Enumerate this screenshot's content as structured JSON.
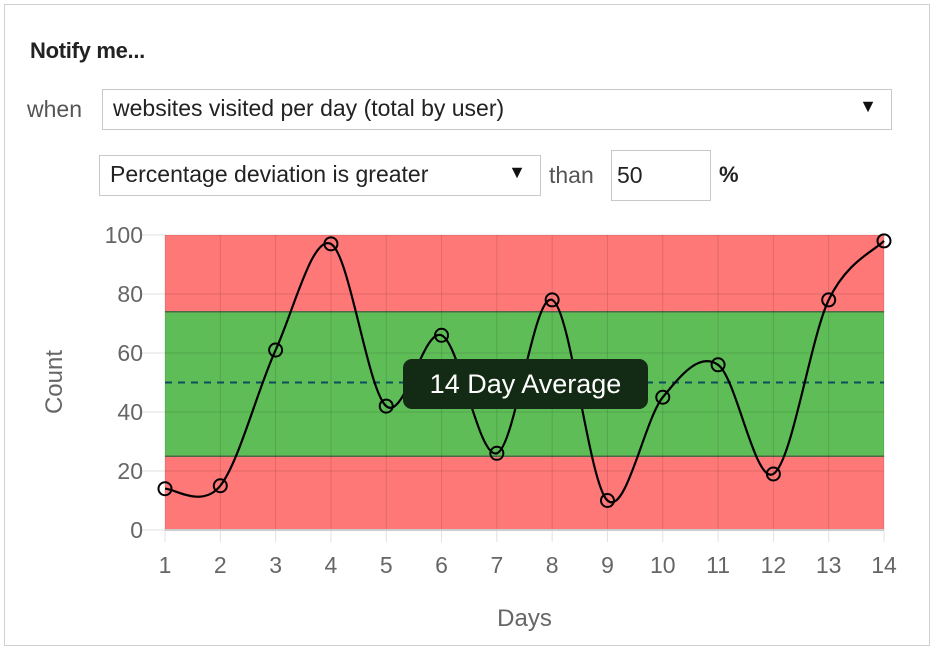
{
  "form": {
    "title": "Notify me...",
    "when_label": "when",
    "metric_select": {
      "value": "websites visited per day (total by user)",
      "arrow": "▼"
    },
    "condition_select": {
      "value": "Percentage deviation is greater",
      "arrow": "▼"
    },
    "than_label": "than",
    "threshold_value": "50",
    "unit": "%"
  },
  "colors": {
    "out_of_range": "#ff7878",
    "in_range": "#5fbd58",
    "average_line": "#0d4d5c",
    "line": "#000000"
  },
  "chart_data": {
    "type": "line",
    "title": "",
    "xlabel": "Days",
    "ylabel": "Count",
    "x": [
      1,
      2,
      3,
      4,
      5,
      6,
      7,
      8,
      9,
      10,
      11,
      12,
      13,
      14
    ],
    "y": [
      14,
      15,
      61,
      97,
      42,
      66,
      26,
      78,
      10,
      45,
      56,
      19,
      78,
      98
    ],
    "ylim": [
      0,
      100
    ],
    "yticks": [
      0,
      20,
      40,
      60,
      80,
      100
    ],
    "xticks": [
      1,
      2,
      3,
      4,
      5,
      6,
      7,
      8,
      9,
      10,
      11,
      12,
      13,
      14
    ],
    "grid": true,
    "average": 50,
    "average_label": "14 Day Average",
    "normal_band": [
      25,
      74
    ],
    "smooth": true
  }
}
